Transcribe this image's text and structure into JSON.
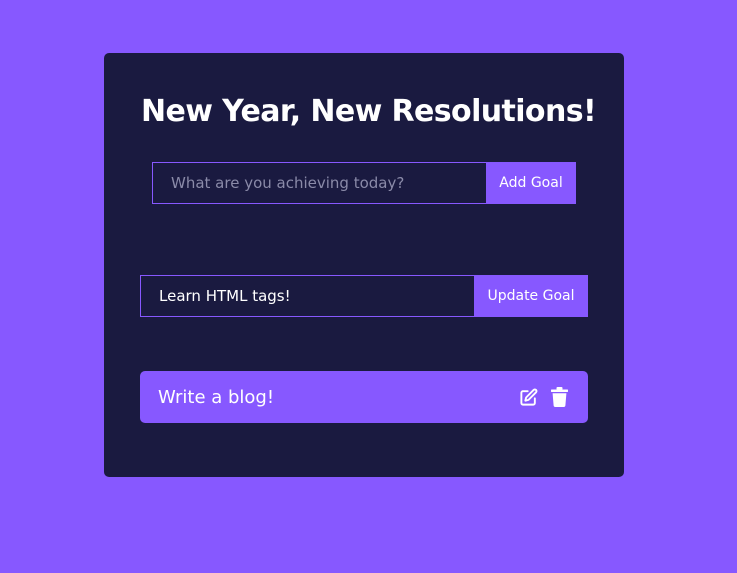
{
  "header": {
    "title": "New Year, New Resolutions!"
  },
  "add_form": {
    "placeholder": "What are you achieving today?",
    "value": "",
    "button_label": "Add Goal"
  },
  "update_form": {
    "value": "Learn HTML tags!",
    "button_label": "Update Goal"
  },
  "todos": [
    {
      "text": "Write a blog!",
      "actions": [
        "edit-icon",
        "trash-icon"
      ]
    }
  ],
  "colors": {
    "page_background": "#8758ff",
    "card_background": "#1a1a40",
    "accent": "#8758ff",
    "text": "#ffffff"
  }
}
